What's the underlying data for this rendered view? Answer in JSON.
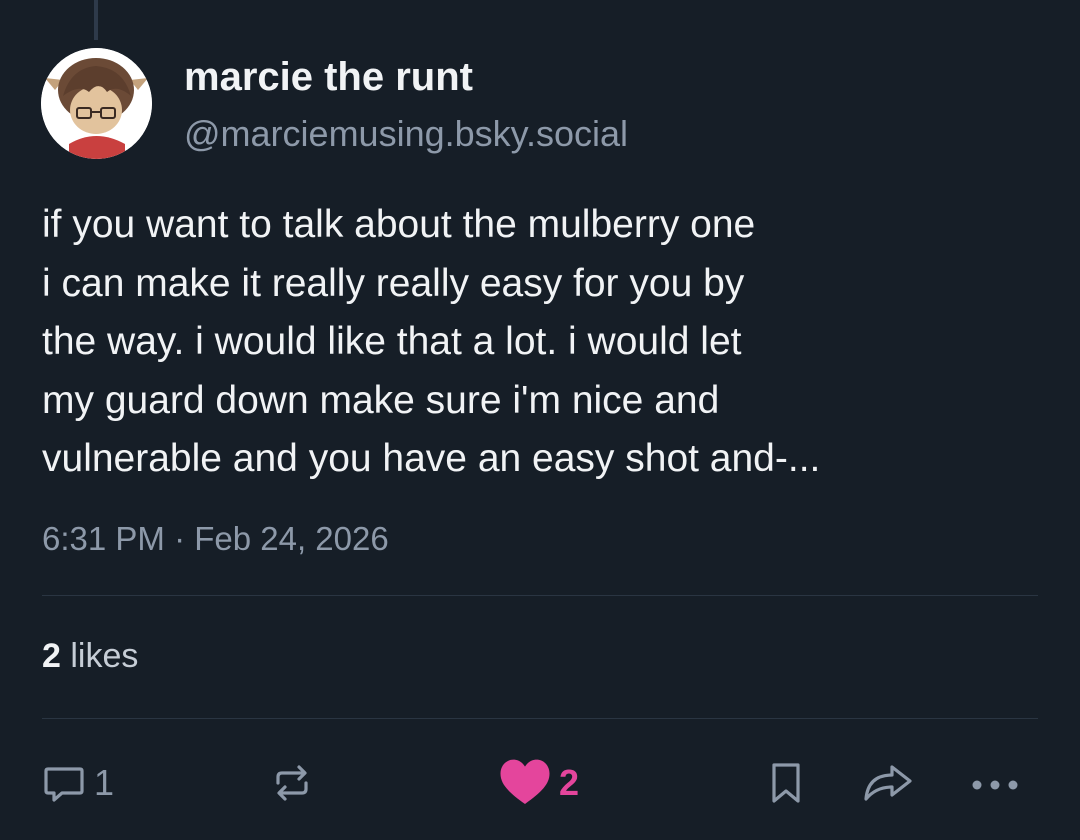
{
  "post": {
    "author": {
      "display_name": "marcie the runt",
      "handle": "@marciemusing.bsky.social"
    },
    "text_lines": [
      "if you want to talk about the mulberry one",
      "i can make it really really easy for you by",
      "the way. i would like that a lot. i would let",
      "my guard down make sure i'm nice and",
      "vulnerable and you have an easy shot and-..."
    ],
    "timestamp": "6:31 PM · Feb 24, 2026",
    "likes": {
      "count": "2",
      "label": "likes"
    }
  },
  "actions": {
    "reply": {
      "icon": "speech-bubble-icon",
      "count": "1"
    },
    "repost": {
      "icon": "repost-arrows-icon"
    },
    "like": {
      "icon": "heart-filled-icon",
      "count": "2",
      "color": "#e4459c",
      "liked": true
    },
    "bookmark": {
      "icon": "bookmark-icon"
    },
    "share": {
      "icon": "share-arrow-icon"
    },
    "more": {
      "icon": "ellipsis-icon"
    }
  },
  "colors": {
    "background": "#161e27",
    "text_primary": "#f1f3f5",
    "text_secondary": "#8d99a9",
    "divider": "#2a3542",
    "like_accent": "#e4459c"
  }
}
